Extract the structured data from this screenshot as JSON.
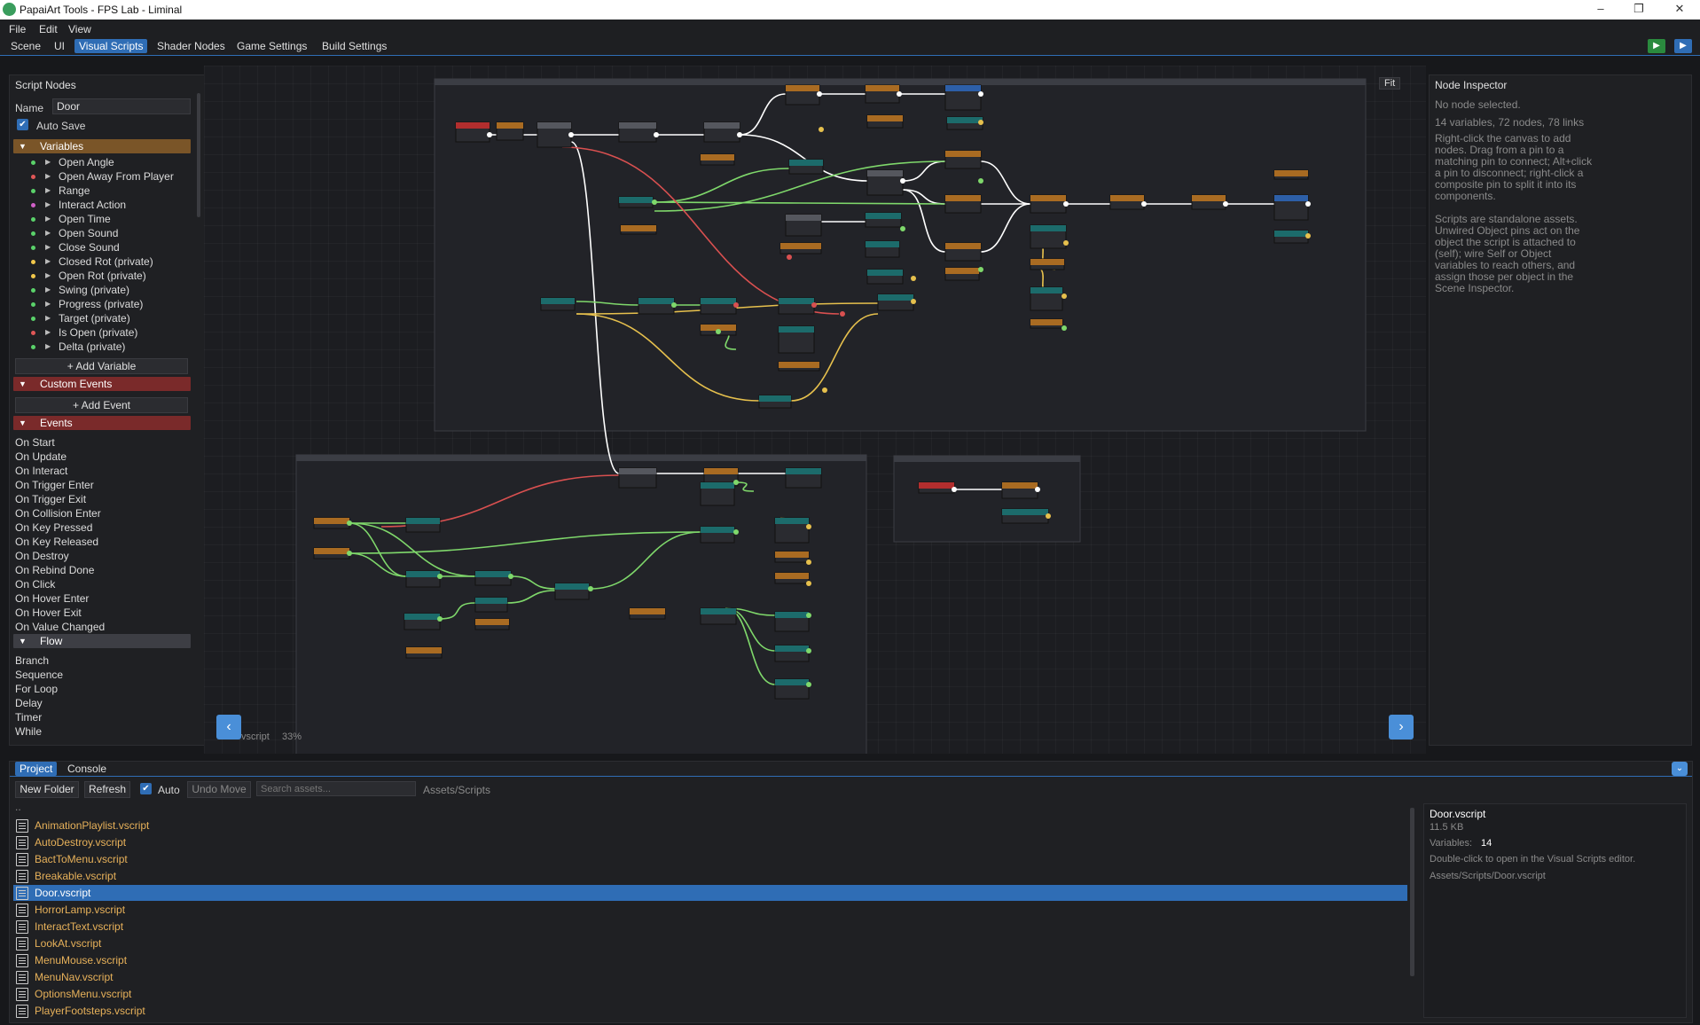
{
  "window": {
    "title": "PapaiArt Tools - FPS Lab - Liminal",
    "minimize": "–",
    "maximize": "❐",
    "close": "✕"
  },
  "menu": [
    "File",
    "Edit",
    "View"
  ],
  "tabs": [
    "Scene",
    "UI",
    "Visual Scripts",
    "Shader Nodes",
    "Game Settings",
    "Build Settings"
  ],
  "active_tab": "Visual Scripts",
  "script_nodes": {
    "title": "Script Nodes",
    "name_label": "Name",
    "name_value": "Door",
    "autosave_label": "Auto Save",
    "variables_header": "Variables",
    "variables": [
      {
        "label": "Open Angle",
        "color": "#5ad26a"
      },
      {
        "label": "Open Away From Player",
        "color": "#e05757"
      },
      {
        "label": "Range",
        "color": "#5ad26a"
      },
      {
        "label": "Interact Action",
        "color": "#d060c8"
      },
      {
        "label": "Open Time",
        "color": "#5ad26a"
      },
      {
        "label": "Open Sound",
        "color": "#5ad26a"
      },
      {
        "label": "Close Sound",
        "color": "#5ad26a"
      },
      {
        "label": "Closed Rot  (private)",
        "color": "#f2c84b"
      },
      {
        "label": "Open Rot  (private)",
        "color": "#f2c84b"
      },
      {
        "label": "Swing  (private)",
        "color": "#5ad26a"
      },
      {
        "label": "Progress  (private)",
        "color": "#5ad26a"
      },
      {
        "label": "Target  (private)",
        "color": "#5ad26a"
      },
      {
        "label": "Is Open  (private)",
        "color": "#e05757"
      },
      {
        "label": "Delta  (private)",
        "color": "#5ad26a"
      }
    ],
    "add_variable": "+ Add Variable",
    "custom_events_header": "Custom Events",
    "add_event": "+ Add Event",
    "events_header": "Events",
    "events": [
      "On Start",
      "On Update",
      "On Interact",
      "On Trigger Enter",
      "On Trigger Exit",
      "On Collision Enter",
      "On Key Pressed",
      "On Key Released",
      "On Destroy",
      "On Rebind Done",
      "On Click",
      "On Hover Enter",
      "On Hover Exit",
      "On Value Changed"
    ],
    "flow_header": "Flow",
    "flow": [
      "Branch",
      "Sequence",
      "For Loop",
      "Delay",
      "Timer",
      "While"
    ]
  },
  "canvas": {
    "fit_label": "Fit",
    "file_label": "vscript",
    "zoom": "33%",
    "prev": "‹",
    "next": "›"
  },
  "inspector": {
    "title": "Node Inspector",
    "status": "No node selected.",
    "stats": "14 variables, 72 nodes, 78 links",
    "help1": "Right-click the canvas to add nodes. Drag from a pin to a matching pin to connect; Alt+click a pin to disconnect; right-click a composite pin to split it into its components.",
    "help2": "Scripts are standalone assets. Unwired Object pins act on the object the script is attached to (self); wire Self or Object variables to reach others, and assign those per object in the Scene Inspector."
  },
  "bottom": {
    "tabs": [
      "Project",
      "Console"
    ],
    "new_folder": "New Folder",
    "refresh": "Refresh",
    "auto_label": "Auto",
    "undo_move": "Undo Move",
    "search_placeholder": "Search assets...",
    "path": "Assets/Scripts",
    "parent": "..",
    "files": [
      "AnimationPlaylist.vscript",
      "AutoDestroy.vscript",
      "BactToMenu.vscript",
      "Breakable.vscript",
      "Door.vscript",
      "HorrorLamp.vscript",
      "InteractText.vscript",
      "LookAt.vscript",
      "MenuMouse.vscript",
      "MenuNav.vscript",
      "OptionsMenu.vscript",
      "PlayerFootsteps.vscript"
    ],
    "selected": "Door.vscript",
    "detail": {
      "name": "Door.vscript",
      "size": "11.5 KB",
      "variables_label": "Variables:",
      "variables_value": "14",
      "hint": "Double-click to open in the Visual Scripts editor.",
      "path": "Assets/Scripts/Door.vscript"
    }
  }
}
